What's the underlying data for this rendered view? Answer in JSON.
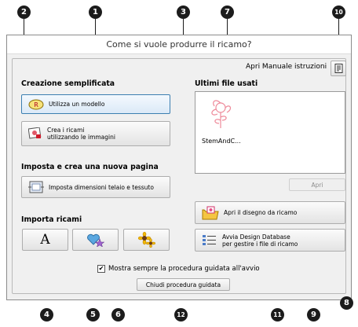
{
  "window": {
    "title": "Come si vuole produrre il ricamo?"
  },
  "manual": {
    "label": "Apri Manuale istruzioni",
    "icon": "manual-icon"
  },
  "quick": {
    "heading": "Creazione semplificata",
    "use_template": "Utilizza un modello",
    "from_images_line1": "Crea i ricami",
    "from_images_line2": "utilizzando le immagini"
  },
  "newpage": {
    "heading": "Imposta e crea una nuova pagina",
    "set_dimensions": "Imposta dimensioni telaio e tessuto"
  },
  "import": {
    "heading": "Importa ricami",
    "font_glyph": "A"
  },
  "recent": {
    "heading": "Ultimi file usati",
    "file_name": "StemAndC...",
    "open_label": "Apri"
  },
  "open_design": "Apri il disegno da ricamo",
  "design_db_line1": "Avvia Design Database",
  "design_db_line2": "per gestire i file di ricamo",
  "startup_checkbox": {
    "label": "Mostra sempre la procedura guidata all'avvio",
    "checked": true
  },
  "close_button": "Chiudi procedura guidata",
  "callouts": [
    "1",
    "2",
    "3",
    "4",
    "5",
    "6",
    "7",
    "8",
    "9",
    "10",
    "11",
    "12"
  ]
}
